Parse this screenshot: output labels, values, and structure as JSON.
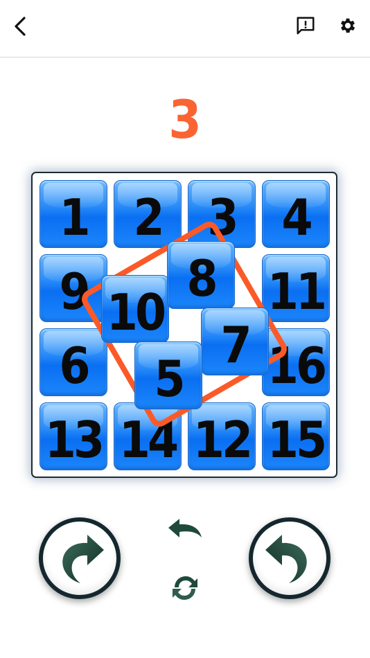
{
  "header": {
    "back_icon": "chevron-left-icon",
    "feedback_icon": "feedback-icon",
    "settings_icon": "gear-icon"
  },
  "game": {
    "moves": "3",
    "tiles": [
      {
        "label": "1"
      },
      {
        "label": "2"
      },
      {
        "label": "3"
      },
      {
        "label": "4"
      },
      {
        "label": "9"
      },
      {
        "label": "11"
      },
      {
        "label": "6"
      },
      {
        "label": "16"
      },
      {
        "label": "13"
      },
      {
        "label": "14"
      },
      {
        "label": "12"
      },
      {
        "label": "15"
      },
      {
        "label": "10"
      },
      {
        "label": "8"
      },
      {
        "label": "7"
      },
      {
        "label": "5"
      }
    ]
  },
  "controls": {
    "rotate_right_icon": "rotate-clockwise-icon",
    "rotate_left_icon": "rotate-counterclockwise-icon",
    "undo_icon": "undo-icon",
    "restart_icon": "restart-icon"
  },
  "colors": {
    "accent": "#fa6433",
    "tile": "#1c86fb",
    "arrow": "#1e4a3a"
  }
}
